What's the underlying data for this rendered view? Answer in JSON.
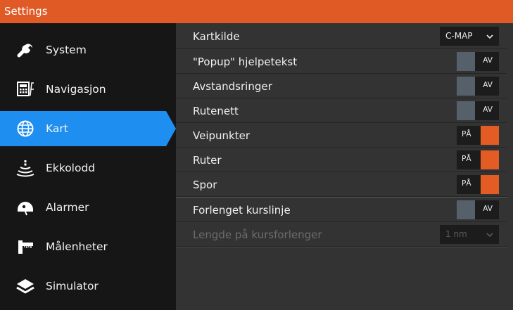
{
  "title": "Settings",
  "sidebar": {
    "items": [
      {
        "label": "System",
        "icon": "wrench-icon",
        "active": false
      },
      {
        "label": "Navigasjon",
        "icon": "navigation-calculator-icon",
        "active": false
      },
      {
        "label": "Kart",
        "icon": "globe-icon",
        "active": true
      },
      {
        "label": "Ekkolodd",
        "icon": "sonar-icon",
        "active": false
      },
      {
        "label": "Alarmer",
        "icon": "alarm-icon",
        "active": false
      },
      {
        "label": "Målenheter",
        "icon": "ruler-icon",
        "active": false
      },
      {
        "label": "Simulator",
        "icon": "layers-icon",
        "active": false
      }
    ]
  },
  "settings": [
    {
      "label": "Kartkilde",
      "control": "dropdown",
      "value": "C-MAP",
      "enabled": true
    },
    {
      "label": "\"Popup\" hjelpetekst",
      "control": "toggle",
      "value": "AV",
      "on": false
    },
    {
      "label": "Avstandsringer",
      "control": "toggle",
      "value": "AV",
      "on": false
    },
    {
      "label": "Rutenett",
      "control": "toggle",
      "value": "AV",
      "on": false
    },
    {
      "label": "Veipunkter",
      "control": "toggle",
      "value": "PÅ",
      "on": true
    },
    {
      "label": "Ruter",
      "control": "toggle",
      "value": "PÅ",
      "on": true
    },
    {
      "label": "Spor",
      "control": "toggle",
      "value": "PÅ",
      "on": true
    },
    {
      "label": "Forlenget kurslinje",
      "control": "toggle",
      "value": "AV",
      "on": false
    },
    {
      "label": "Lengde på kursforlenger",
      "control": "dropdown",
      "value": "1 nm",
      "enabled": false
    }
  ],
  "colors": {
    "accent": "#e05a26",
    "active_tab": "#1e8ff0",
    "toggle_on": "#e35c23",
    "toggle_off": "#56606b"
  }
}
